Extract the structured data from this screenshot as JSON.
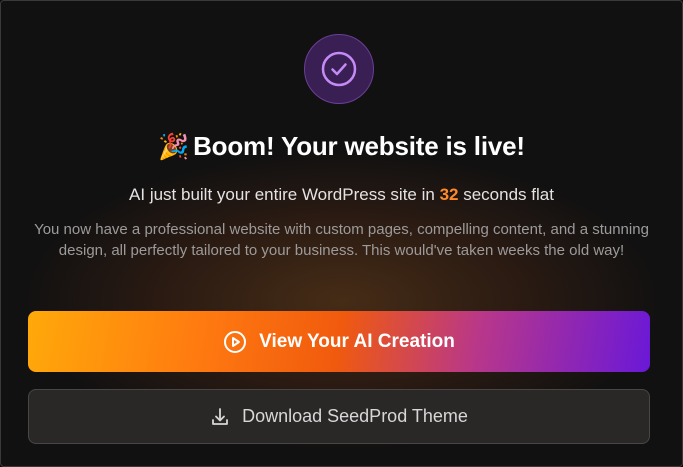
{
  "success": {
    "icon": "check-circle-icon",
    "title_emoji": "🎉",
    "title": "Boom! Your website is live!",
    "subtitle_prefix": "AI just built your entire WordPress site in ",
    "subtitle_number": "32",
    "subtitle_suffix": " seconds flat",
    "description": "You now have a professional website with custom pages, compelling content, and a stunning design, all perfectly tailored to your business. This would've taken weeks the old way!"
  },
  "actions": {
    "primary_label": "View Your AI Creation",
    "primary_icon": "play-circle-icon",
    "secondary_label": "Download SeedProd Theme",
    "secondary_icon": "download-icon"
  },
  "colors": {
    "accent_orange": "#ff8a2a",
    "accent_purple": "#6a18d8",
    "check_purple": "#c58af5"
  }
}
